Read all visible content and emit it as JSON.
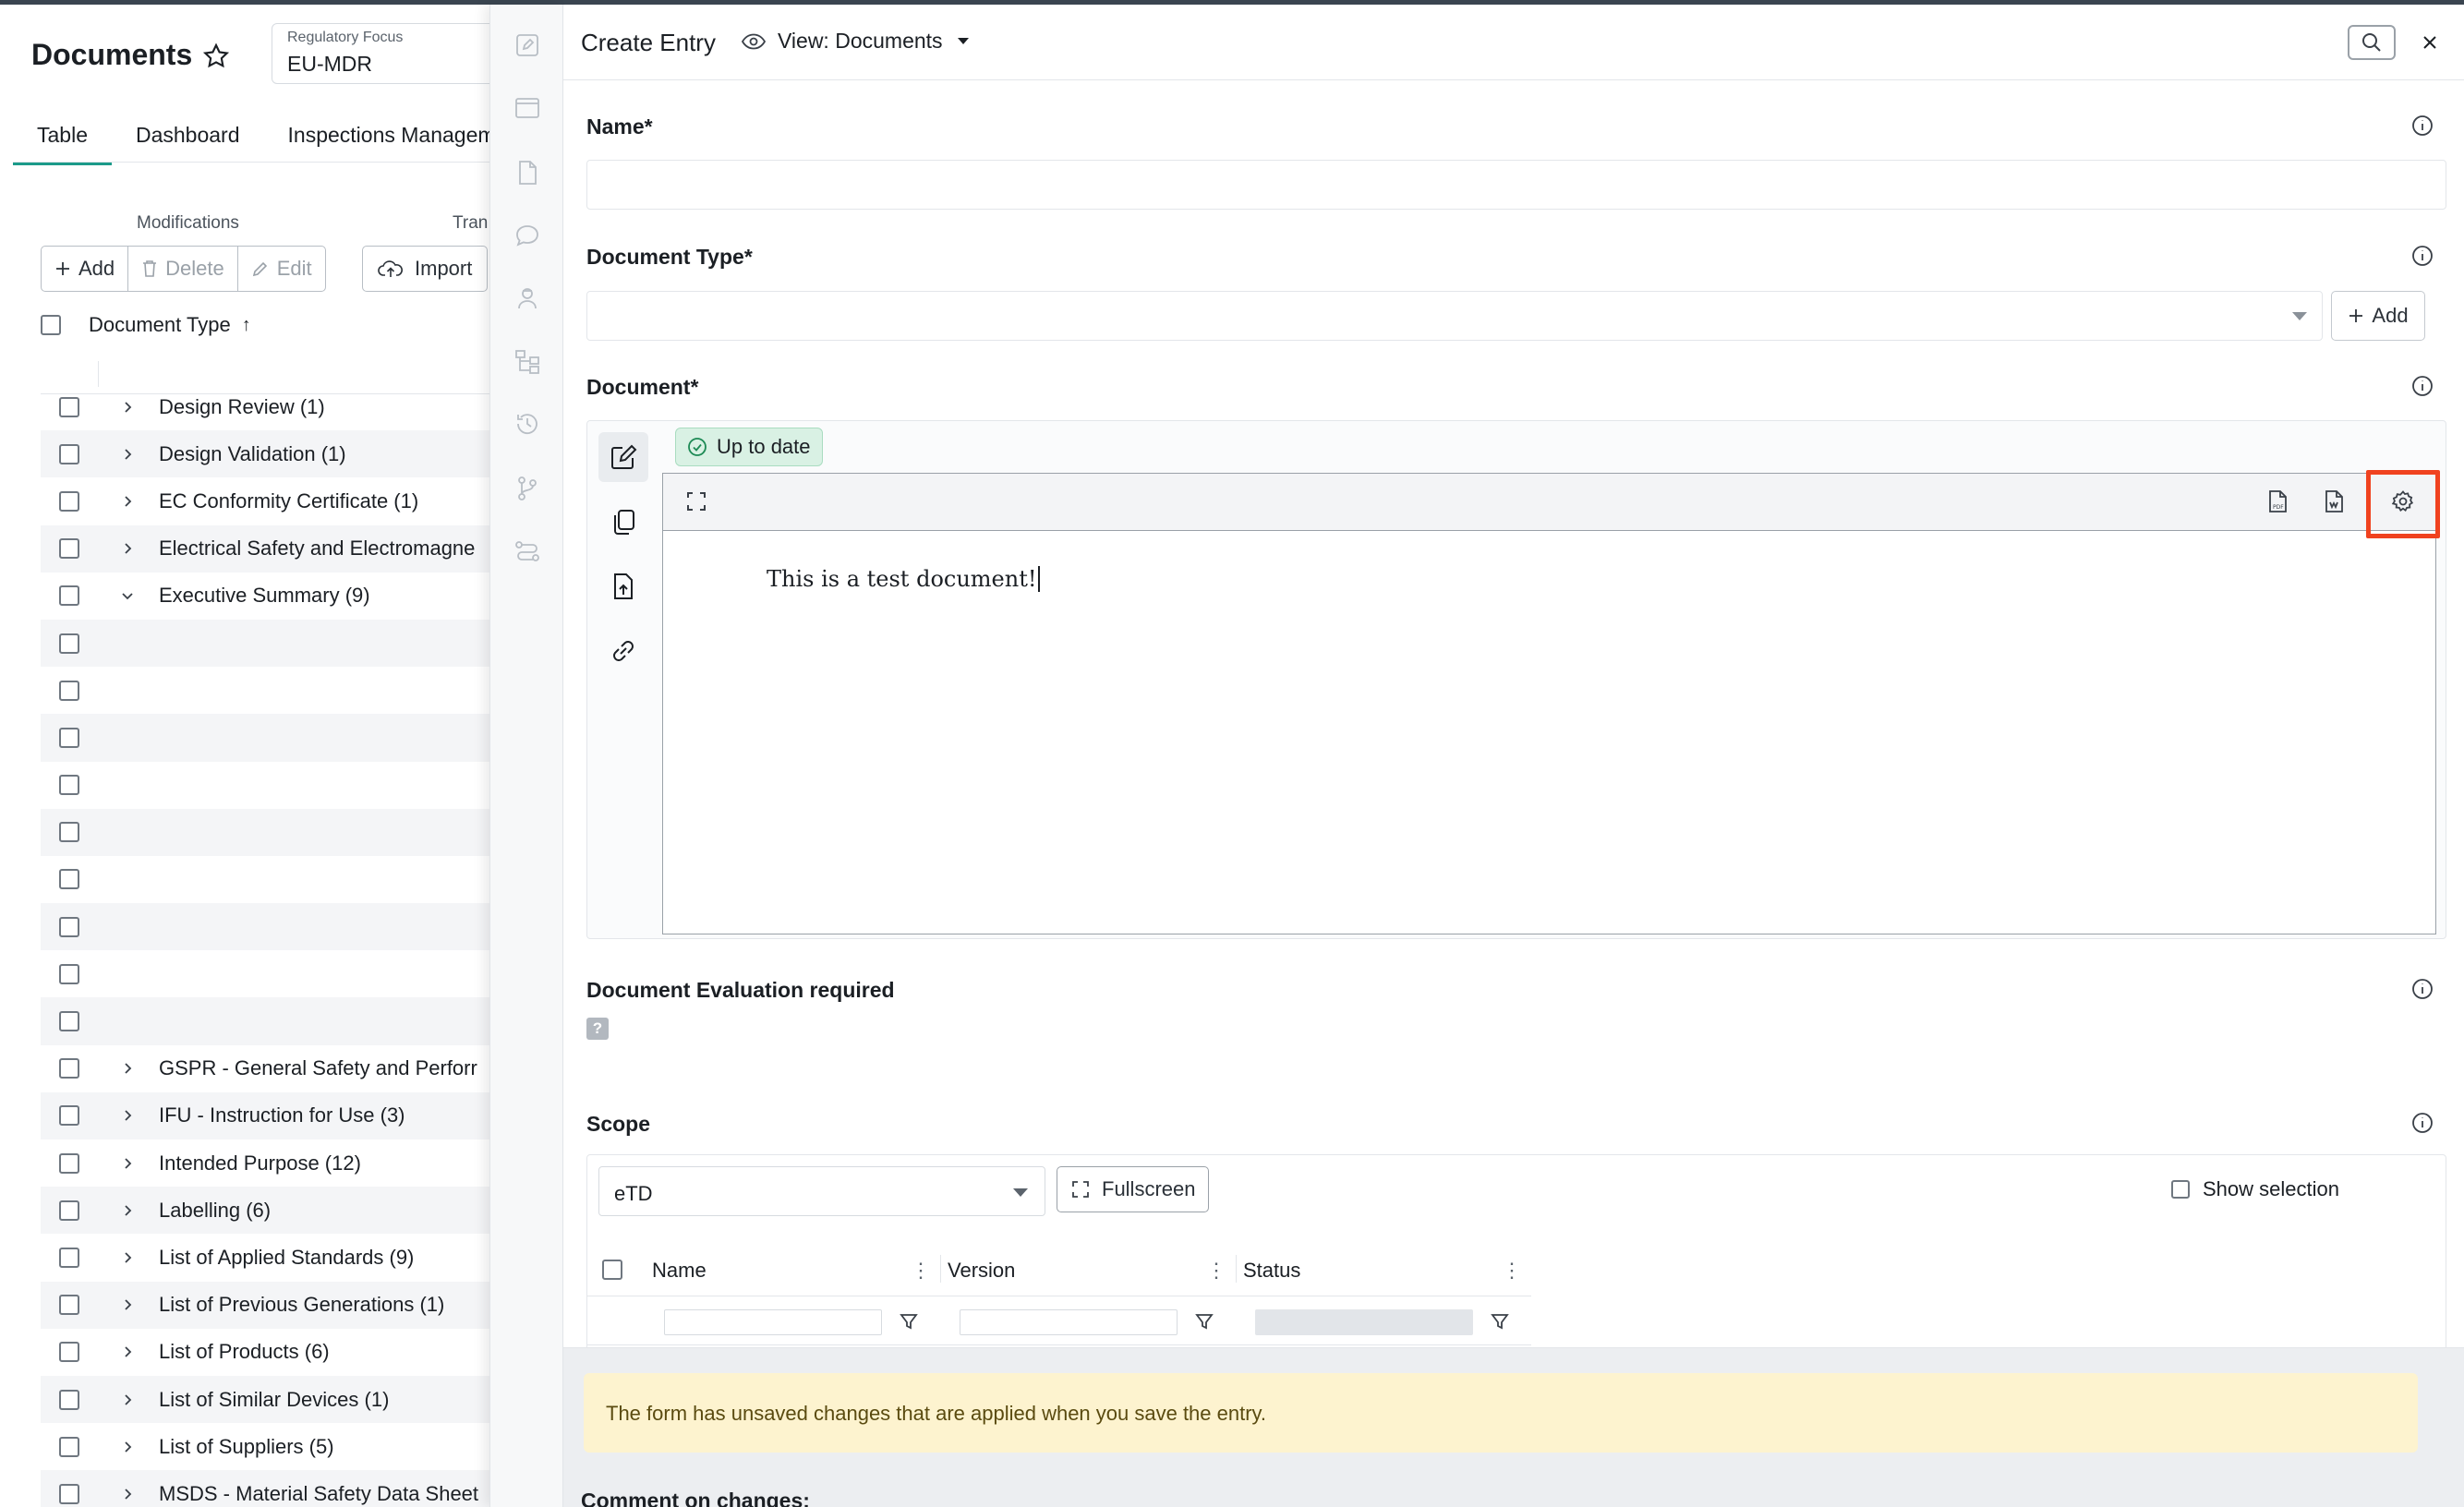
{
  "app": {
    "title": "Documents",
    "regulatory_focus": {
      "label": "Regulatory Focus",
      "value": "EU-MDR"
    },
    "tabs": [
      {
        "label": "Table"
      },
      {
        "label": "Dashboard"
      },
      {
        "label": "Inspections Managem"
      }
    ],
    "toolbar": {
      "modifications_label": "Modifications",
      "transfer_label": "Tran",
      "add_label": "Add",
      "delete_label": "Delete",
      "edit_label": "Edit",
      "import_label": "Import"
    },
    "table": {
      "column_header": "Document Type",
      "sort_indicator": "↑",
      "rows": [
        {
          "label": "Design Review (1)",
          "expandable": true
        },
        {
          "label": "Design Validation (1)",
          "expandable": true
        },
        {
          "label": "EC Conformity Certificate (1)",
          "expandable": true
        },
        {
          "label": "Electrical Safety and Electromagne",
          "expandable": true
        },
        {
          "label": "Executive Summary (9)",
          "expandable": true,
          "expanded": true
        },
        {
          "label": ""
        },
        {
          "label": ""
        },
        {
          "label": ""
        },
        {
          "label": ""
        },
        {
          "label": ""
        },
        {
          "label": ""
        },
        {
          "label": ""
        },
        {
          "label": ""
        },
        {
          "label": ""
        },
        {
          "label": "GSPR - General Safety and Perforr",
          "expandable": true
        },
        {
          "label": "IFU - Instruction for Use (3)",
          "expandable": true
        },
        {
          "label": "Intended Purpose (12)",
          "expandable": true
        },
        {
          "label": "Labelling (6)",
          "expandable": true
        },
        {
          "label": "List of Applied Standards (9)",
          "expandable": true
        },
        {
          "label": "List of Previous Generations (1)",
          "expandable": true
        },
        {
          "label": "List of Products (6)",
          "expandable": true
        },
        {
          "label": "List of Similar Devices (1)",
          "expandable": true
        },
        {
          "label": "List of Suppliers (5)",
          "expandable": true
        },
        {
          "label": "MSDS - Material Safety Data Sheet",
          "expandable": true
        }
      ]
    }
  },
  "drawer": {
    "title": "Create Entry",
    "view_label": "View: Documents",
    "fields": {
      "name": {
        "label": "Name*",
        "value": ""
      },
      "document_type": {
        "label": "Document Type*",
        "value": "",
        "add_label": "Add"
      },
      "document": {
        "label": "Document*",
        "status_badge": "Up to date",
        "content": "This is a test document!"
      },
      "evaluation": {
        "label": "Document Evaluation required",
        "value": "?"
      },
      "scope": {
        "label": "Scope",
        "selected": "eTD",
        "fullscreen_label": "Fullscreen",
        "show_selection_label": "Show selection",
        "columns": [
          {
            "label": "Name"
          },
          {
            "label": "Version"
          },
          {
            "label": "Status"
          }
        ]
      }
    },
    "footer": {
      "warning": "The form has unsaved changes that are applied when you save the entry.",
      "comment_label": "Comment on changes:"
    }
  },
  "colors": {
    "accent": "#1c9b8a",
    "highlight": "#f0421f",
    "warning_bg": "#fdf3cf",
    "badge_bg": "#d9f1e4"
  }
}
